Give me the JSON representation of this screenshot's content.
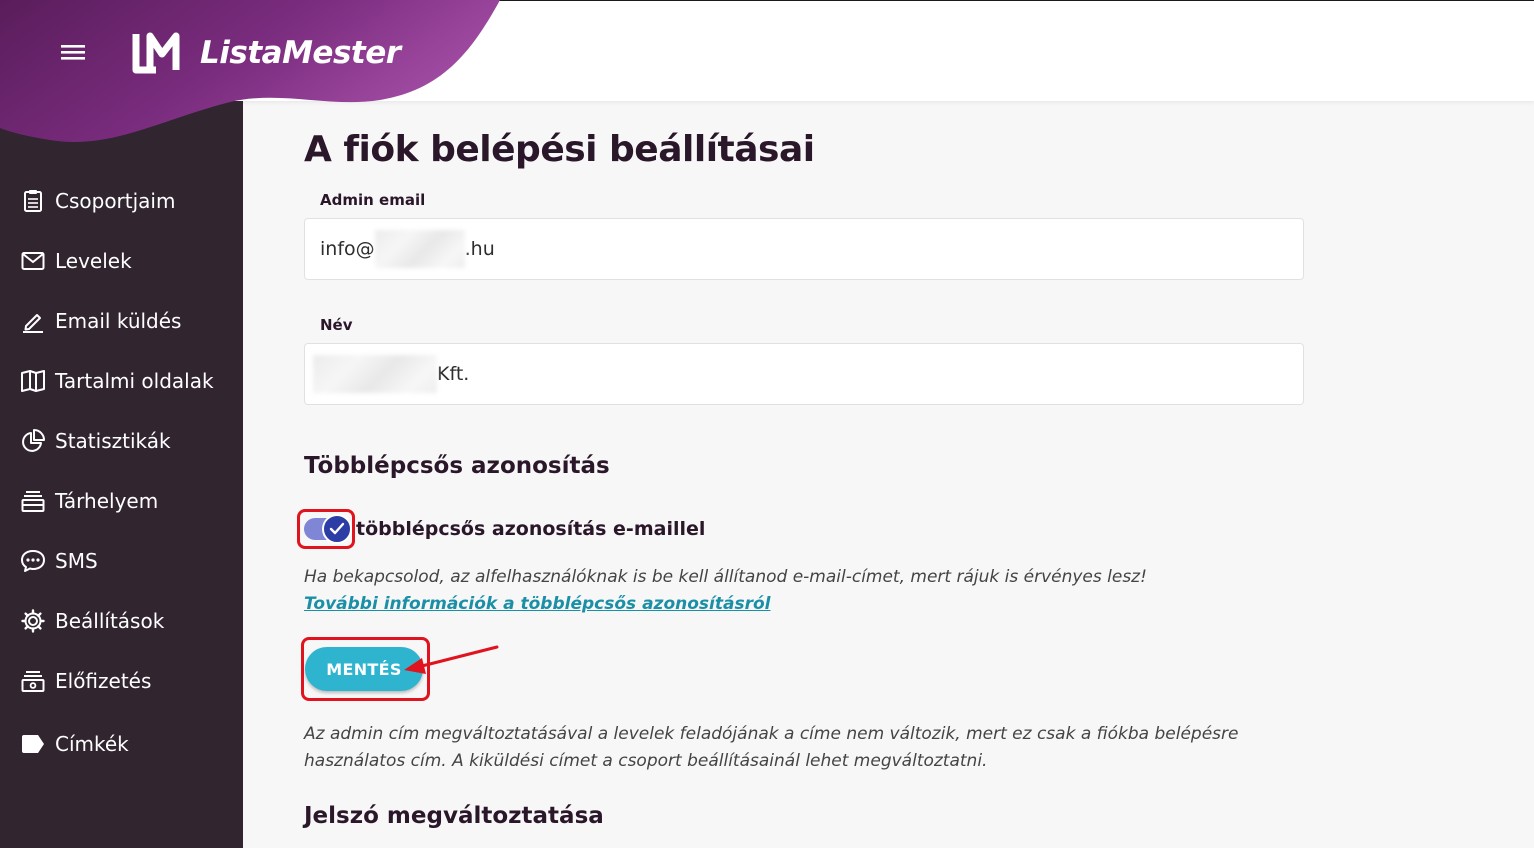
{
  "brand": {
    "name": "ListaMester",
    "color": "#7a2c7e"
  },
  "header": {
    "menu_icon": "hamburger-menu-icon"
  },
  "sidebar": {
    "items": [
      {
        "label": "Csoportjaim",
        "icon": "clipboard-list-icon"
      },
      {
        "label": "Levelek",
        "icon": "envelope-icon"
      },
      {
        "label": "Email küldés",
        "icon": "pencil-icon"
      },
      {
        "label": "Tartalmi oldalak",
        "icon": "book-open-icon"
      },
      {
        "label": "Statisztikák",
        "icon": "pie-chart-icon"
      },
      {
        "label": "Tárhelyem",
        "icon": "storage-tray-icon"
      },
      {
        "label": "SMS",
        "icon": "chat-bubble-icon"
      },
      {
        "label": "Beállítások",
        "icon": "gear-icon"
      },
      {
        "label": "Előfizetés",
        "icon": "subscription-box-icon"
      },
      {
        "label": "Címkék",
        "icon": "tag-icon"
      }
    ]
  },
  "main": {
    "title": "A fiók belépési beállításai",
    "admin_email": {
      "label": "Admin email",
      "value_prefix": "info@",
      "value_suffix": ".hu"
    },
    "name": {
      "label": "Név",
      "value_suffix": "Kft."
    },
    "mfa": {
      "title": "Többlépcsős azonosítás",
      "toggle_label": "többlépcsős azonosítás e-maillel",
      "enabled": true,
      "hint": "Ha bekapcsolod, az alfelhasználóknak is be kell állítanod e-mail-címet, mert rájuk is érvényes lesz!",
      "link": "További információk a többlépcsős azonosításról"
    },
    "save_label": "MENTÉS",
    "note": "Az admin cím megváltoztatásával a levelek feladójának a címe nem változik, mert ez csak a fiókba belépésre használatos cím. A kiküldési címet a csoport beállításainál lehet megváltoztatni.",
    "password_title": "Jelszó megváltoztatása"
  },
  "colors": {
    "accent": "#2fb4d0",
    "highlight": "#e0141e",
    "sidebar": "#312530",
    "toggle": "#2c3ea6"
  }
}
